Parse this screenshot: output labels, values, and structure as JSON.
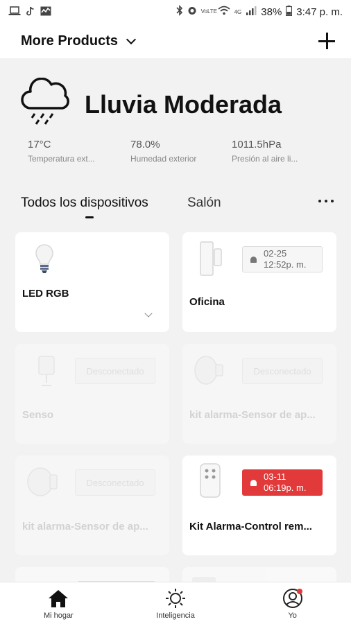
{
  "status_bar": {
    "battery": "38%",
    "time": "3:47 p. m.",
    "network_label": "4G",
    "volte_label": "VoLTE"
  },
  "header": {
    "home_name": "More Products"
  },
  "weather": {
    "condition": "Lluvia Moderada",
    "stats": [
      {
        "value": "17°C",
        "label": "Temperatura ext..."
      },
      {
        "value": "78.0%",
        "label": "Humedad exterior"
      },
      {
        "value": "1011.5hPa",
        "label": "Presión al aire li..."
      }
    ]
  },
  "tabs": {
    "all": "Todos los dispositivos",
    "room": "Salón"
  },
  "devices": [
    {
      "name": "LED RGB"
    },
    {
      "name": "Oficina",
      "badge_date": "02-25",
      "badge_time": "12:52p. m."
    },
    {
      "name": "Senso",
      "badge": "Desconectado"
    },
    {
      "name": "kit alarma-Sensor de ap...",
      "badge": "Desconectado"
    },
    {
      "name": "kit alarma-Sensor de ap...",
      "badge": "Desconectado"
    },
    {
      "name": "Kit Alarma-Control rem...",
      "badge_date": "03-11",
      "badge_time": "06:19p. m.",
      "badge_color": "#e23a3a"
    }
  ],
  "bottom_nav": [
    {
      "label": "Mi hogar",
      "icon": "home-icon"
    },
    {
      "label": "Inteligencia",
      "icon": "sun-icon"
    },
    {
      "label": "Yo",
      "icon": "profile-icon"
    }
  ],
  "colors": {
    "accent": "#e23a3a",
    "background": "#f2f2f2"
  }
}
